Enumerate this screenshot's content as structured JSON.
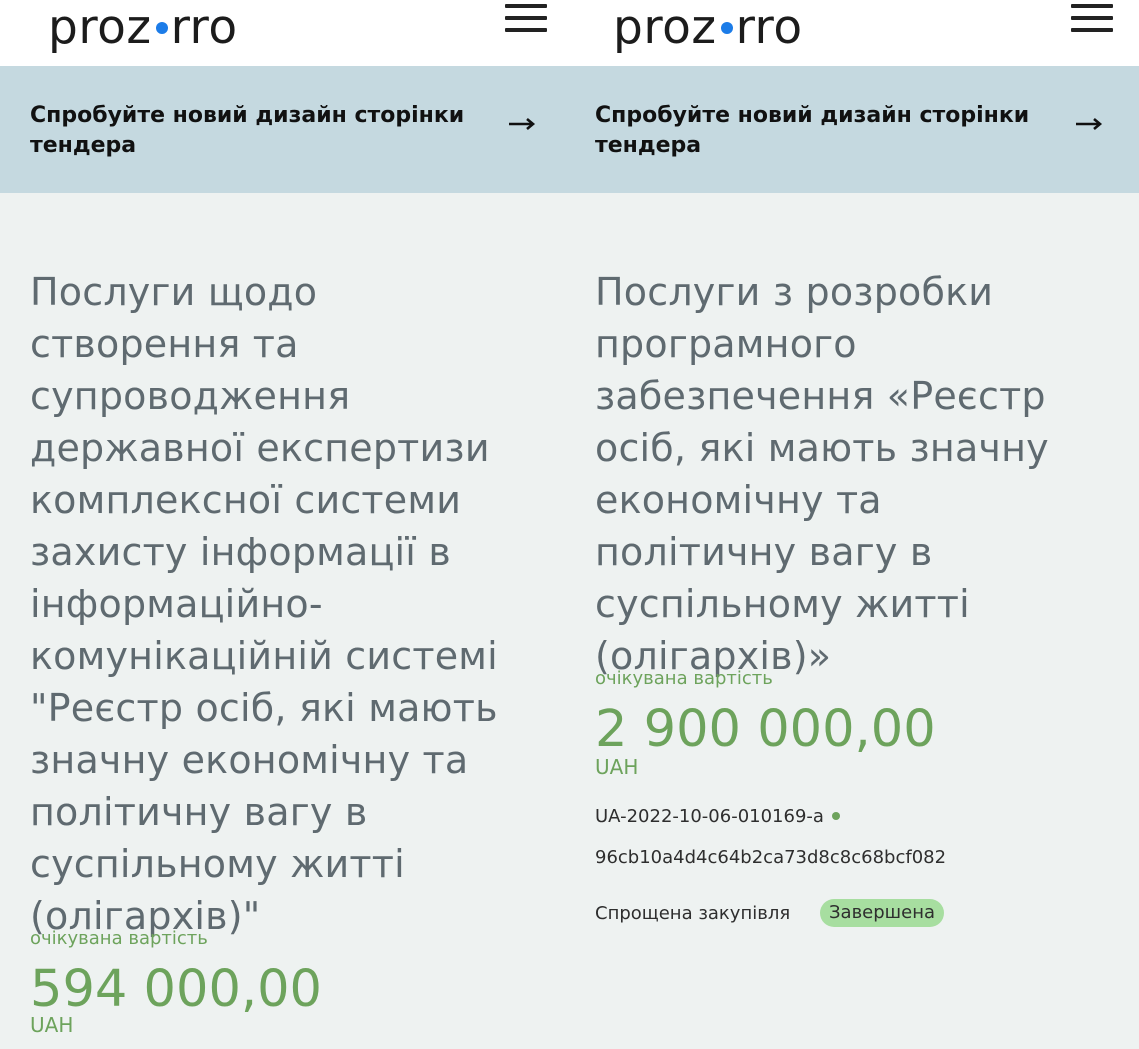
{
  "colors": {
    "accent_green": "#6da35c",
    "logo_dot_blue": "#1c7ce8",
    "banner_bg": "#c5d9e0",
    "status_badge_bg": "#a7dea0",
    "tender_id_dot": "#6da35c"
  },
  "left": {
    "header": {
      "logo_text_before": "proz",
      "logo_text_after": "rro",
      "menu_icon": "hamburger-menu-icon"
    },
    "banner": {
      "text": "Спробуйте новий дизайн сторінки тендера",
      "arrow_icon": "arrow-right-icon"
    },
    "tender": {
      "title": "Послуги щодо створення та супроводження державної експертизи комплексної системи захисту інформації в інформаційно-комунікаційній системі \"Реєстр осіб, які мають значну економічну та політичну вагу в суспільному житті (олігархів)\"",
      "expected_value_label": "очікувана вартість",
      "amount": "594 000,00",
      "currency": "UAH"
    }
  },
  "right": {
    "header": {
      "logo_text_before": "proz",
      "logo_text_after": "rro",
      "menu_icon": "hamburger-menu-icon"
    },
    "banner": {
      "text": "Спробуйте новий дизайн сторінки тендера",
      "arrow_icon": "arrow-right-icon"
    },
    "tender": {
      "title": "Послуги з розробки програмного забезпечення «Реєстр осіб, які мають значну економічну та політичну вагу в суспільному житті (олігархів)»",
      "expected_value_label": "очікувана вартість",
      "amount": "2 900 000,00",
      "currency": "UAH",
      "tender_id": "UA-2022-10-06-010169-a",
      "hash": "96cb10a4d4c64b2ca73d8c8c68bcf082",
      "procurement_type": "Спрощена закупівля",
      "status": "Завершена"
    }
  }
}
